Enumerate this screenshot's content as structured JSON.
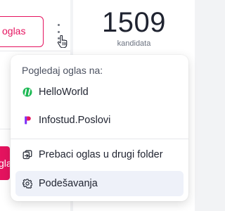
{
  "background": {
    "oglas_button_label": "oglas",
    "pink_button_label": "gla",
    "candidate_count": "1509",
    "candidate_label": "kandidata"
  },
  "menu": {
    "heading": "Pogledaj oglas na:",
    "items": [
      {
        "label": "HelloWorld",
        "icon": "helloworld-logo-icon"
      },
      {
        "label": "Infostud.Poslovi",
        "icon": "infostud-logo-icon"
      },
      {
        "label": "Prebaci oglas u drugi folder",
        "icon": "move-folder-icon"
      },
      {
        "label": "Podešavanja",
        "icon": "gear-icon"
      }
    ]
  },
  "colors": {
    "accent": "#e5135f",
    "helloworld_green": "#1db954",
    "menu_hover": "#eef1f9"
  }
}
